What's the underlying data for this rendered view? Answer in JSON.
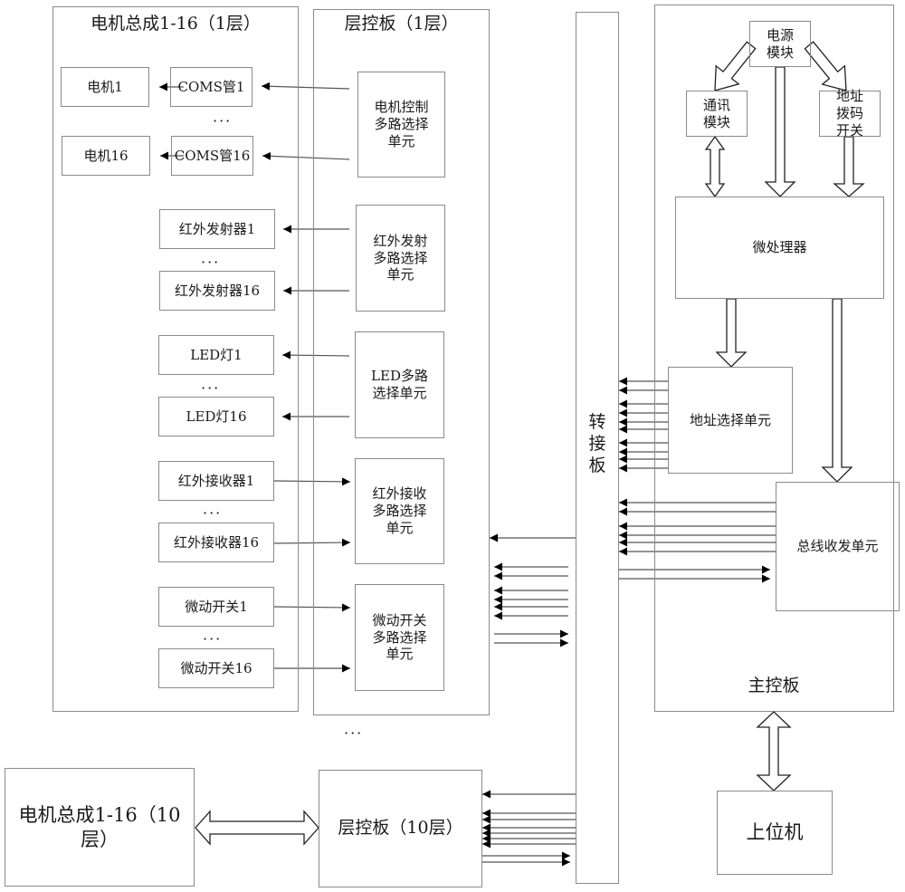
{
  "diagram": {
    "layer1_motor_assembly": {
      "title": "电机总成1-16（1层）",
      "motors": [
        "电机1",
        "电机16"
      ],
      "coms": [
        "COMS管1",
        "COMS管16"
      ],
      "ir_emitters": [
        "红外发射器1",
        "红外发射器16"
      ],
      "leds": [
        "LED灯1",
        "LED灯16"
      ],
      "ir_receivers": [
        "红外接收器1",
        "红外接收器16"
      ],
      "micro_switches": [
        "微动开关1",
        "微动开关16"
      ],
      "ellipsis": "···"
    },
    "layer1_control_board": {
      "title": "层控板（1层）",
      "units": [
        "电机控制\n多路选择\n单元",
        "红外发射\n多路选择\n单元",
        "LED多路\n选择单元",
        "红外接收\n多路选择\n单元",
        "微动开关\n多路选择\n单元"
      ]
    },
    "transfer_board": {
      "title": "转\n接\n板"
    },
    "main_board": {
      "title": "主控板",
      "power_module": "电源\n模块",
      "comm_module": "通讯\n模块",
      "dip_switch": "地址\n拨码\n开关",
      "microprocessor": "微处理器",
      "address_select_unit": "地址选择单元",
      "bus_transceiver_unit": "总线收发单元"
    },
    "between_layers_ellipsis": "···",
    "layer10_motor_assembly": {
      "title": "电机总成1-16（10\n层）"
    },
    "layer10_control_board": {
      "title": "层控板（10层）"
    },
    "host_computer": {
      "title": "上位机"
    }
  }
}
